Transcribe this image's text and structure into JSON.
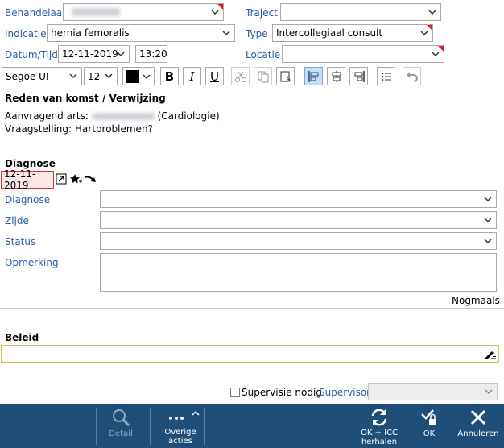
{
  "header": {
    "behandelaar_label": "Behandelaar",
    "traject_label": "Traject",
    "traject_value": "",
    "indicatie_label": "Indicatie",
    "indicatie_value": "hernia femoralis",
    "type_label": "Type",
    "type_value": "Intercollegiaal consult",
    "datum_label": "Datum/Tijd",
    "datum_value": "12-11-2019",
    "tijd_value": "13:20",
    "locatie_label": "Locatie",
    "locatie_value": ""
  },
  "toolbar": {
    "font_family": "Segoe UI",
    "font_size": "12",
    "bold": "B",
    "italic": "I",
    "underline": "U"
  },
  "reden": {
    "title": "Reden van komst / Verwijzing",
    "aanvragend_prefix": "Aanvragend arts:",
    "aanvragend_suffix": "(Cardiologie)",
    "vraagstelling": "Vraagstelling: Hartproblemen?"
  },
  "diagnose": {
    "title": "Diagnose",
    "date": "12-11-2019",
    "diagnose_label": "Diagnose",
    "zijde_label": "Zijde",
    "status_label": "Status",
    "opmerking_label": "Opmerking",
    "nogmaals_link": "Nogmaals"
  },
  "beleid": {
    "title": "Beleid"
  },
  "supervision": {
    "checkbox_label": "Supervisie nodig",
    "supervisor_label": "Supervisor"
  },
  "footer": {
    "detail": "Detail",
    "overige_line1": "Overige",
    "overige_line2": "acties",
    "okicc_line1": "OK + ICC",
    "okicc_line2": "herhalen",
    "ok": "OK",
    "annuleren": "Annuleren"
  },
  "colors": {
    "label_blue": "#2a5ea8",
    "footer_bg": "#1f4e79",
    "required_red": "#e02020",
    "date_highlight": "#d9383a"
  }
}
